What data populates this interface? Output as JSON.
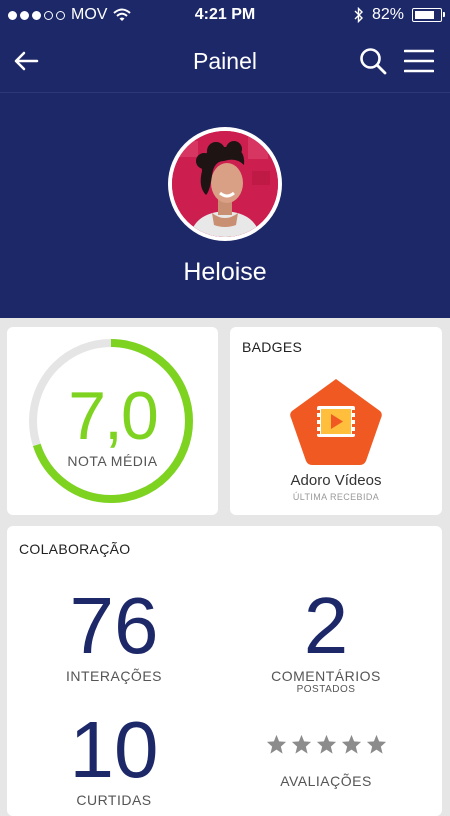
{
  "status_bar": {
    "carrier": "MOV",
    "time": "4:21 PM",
    "battery_percent": "82%",
    "battery_level": 0.82
  },
  "nav": {
    "title": "Painel"
  },
  "profile": {
    "name": "Heloise"
  },
  "score_card": {
    "value": "7,0",
    "label": "NOTA MÉDIA",
    "progress": 0.7,
    "color": "#7ed321"
  },
  "badges_card": {
    "title": "BADGES",
    "badge_name": "Adoro Vídeos",
    "badge_sub": "ÚLTIMA RECEBIDA",
    "badge_color": "#f05a22",
    "badge_icon": "video-icon"
  },
  "collab_card": {
    "title": "COLABORAÇÃO",
    "stats": [
      {
        "value": "76",
        "label": "INTERAÇÕES",
        "sub": ""
      },
      {
        "value": "2",
        "label": "COMENTÁRIOS",
        "sub": "POSTADOS"
      },
      {
        "value": "10",
        "label": "CURTIDAS",
        "sub": ""
      },
      {
        "value": "",
        "label": "AVALIAÇÕES",
        "sub": "",
        "stars": 5
      }
    ]
  },
  "colors": {
    "header": "#1d2869",
    "background": "#e6e6e6",
    "accent": "#7ed321"
  }
}
